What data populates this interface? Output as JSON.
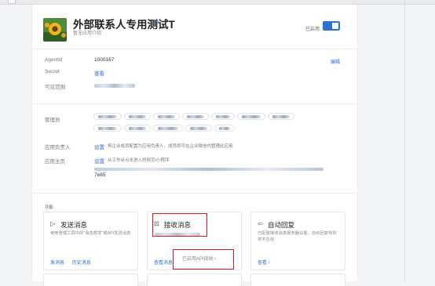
{
  "app": {
    "name": "外部联系人专用测试T",
    "description": "暂无应用介绍",
    "enabled_label": "已启用",
    "enabled": true
  },
  "details": {
    "agentid_label": "AgentId",
    "agentid_value": "1000167",
    "edit_label": "编辑",
    "secret_label": "Secret",
    "secret_value": "查看",
    "visible_label": "可见范围",
    "admin_label": "管理员",
    "owner_label": "应用负责人",
    "owner_action": "设置",
    "owner_hint": "将企业成员配置为应用负责人，成员即可在企业微信内管理此应用",
    "homepage_label": "应用主页",
    "homepage_action": "设置",
    "homepage_hint": "从工作台点击进入的网页/小程序",
    "homepage_suffix": "7e65"
  },
  "features": {
    "section_title": "功能",
    "cards": [
      {
        "icon": "send-icon",
        "glyph": "▷",
        "name": "发送消息",
        "desc": "使用管理工具中的\"消息群发\"或API发送消息",
        "actions": [
          "发消息",
          "历史消息"
        ]
      },
      {
        "icon": "chat-icon",
        "glyph": "⊡",
        "name": "接收消息",
        "desc": "",
        "actions": [
          "查看消息"
        ],
        "badge": "已启用API接收 ›"
      },
      {
        "icon": "reply-icon",
        "glyph": "⇦",
        "name": "自动回复",
        "desc": "已配置接收消息服务器设置，自动回复规则将不生效",
        "actions": [
          "查看 ›"
        ]
      }
    ]
  },
  "colors": {
    "accent": "#2b6fd6",
    "highlight": "#e0191e",
    "toggle": "#2b72d8"
  }
}
